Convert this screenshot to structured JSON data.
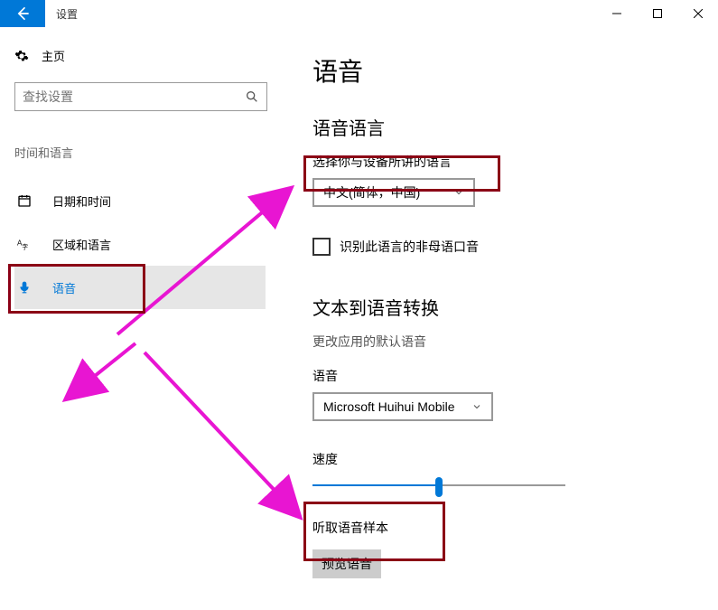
{
  "title": "设置",
  "sidebar": {
    "home": "主页",
    "search_placeholder": "查找设置",
    "category": "时间和语言",
    "items": [
      {
        "label": "日期和时间"
      },
      {
        "label": "区域和语言"
      },
      {
        "label": "语音"
      }
    ]
  },
  "main": {
    "page_heading": "语音",
    "section_lang": {
      "heading": "语音语言",
      "subtitle": "选择你与设备所讲的语言",
      "dropdown_value": "中文(简体，中国)",
      "checkbox_label": "识别此语言的非母语口音"
    },
    "section_tts": {
      "heading": "文本到语音转换",
      "subtitle": "更改应用的默认语音",
      "voice_label": "语音",
      "voice_value": "Microsoft Huihui Mobile",
      "speed_label": "速度",
      "sample_label": "听取语音样本",
      "preview_btn": "预览语音"
    }
  }
}
